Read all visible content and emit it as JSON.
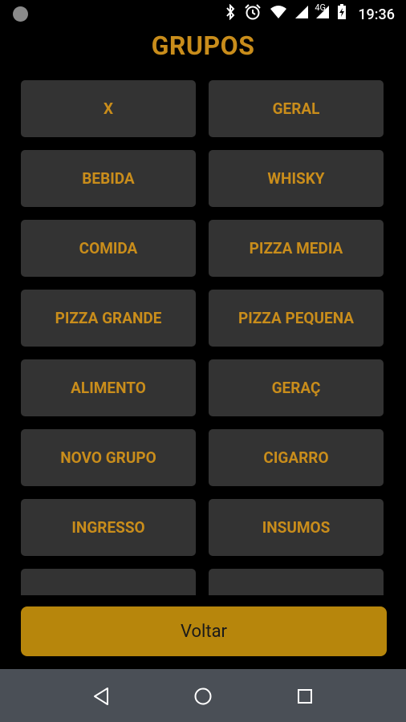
{
  "status_bar": {
    "time": "19:36",
    "network_label": "4G",
    "icons": [
      "notification-dot-icon",
      "bluetooth-icon",
      "alarm-icon",
      "wifi-icon",
      "signal-icon",
      "signal-4g-icon",
      "battery-charging-icon"
    ]
  },
  "page": {
    "title": "GRUPOS"
  },
  "groups": [
    {
      "label": "X"
    },
    {
      "label": "GERAL"
    },
    {
      "label": "BEBIDA"
    },
    {
      "label": "WHISKY"
    },
    {
      "label": "COMIDA"
    },
    {
      "label": "PIZZA MEDIA"
    },
    {
      "label": "PIZZA GRANDE"
    },
    {
      "label": "PIZZA PEQUENA"
    },
    {
      "label": "ALIMENTO"
    },
    {
      "label": "GERAÇ"
    },
    {
      "label": "NOVO GRUPO"
    },
    {
      "label": "CIGARRO"
    },
    {
      "label": "INGRESSO"
    },
    {
      "label": "INSUMOS"
    },
    {
      "label": ""
    },
    {
      "label": ""
    }
  ],
  "footer": {
    "back_label": "Voltar"
  },
  "colors": {
    "accent": "#c98d1b",
    "button_bg": "#333333",
    "back_bg": "#b7860c",
    "nav_bg": "#4a4f56"
  },
  "nav_bar": {
    "icons": [
      "back-icon",
      "home-icon",
      "recents-icon"
    ]
  }
}
